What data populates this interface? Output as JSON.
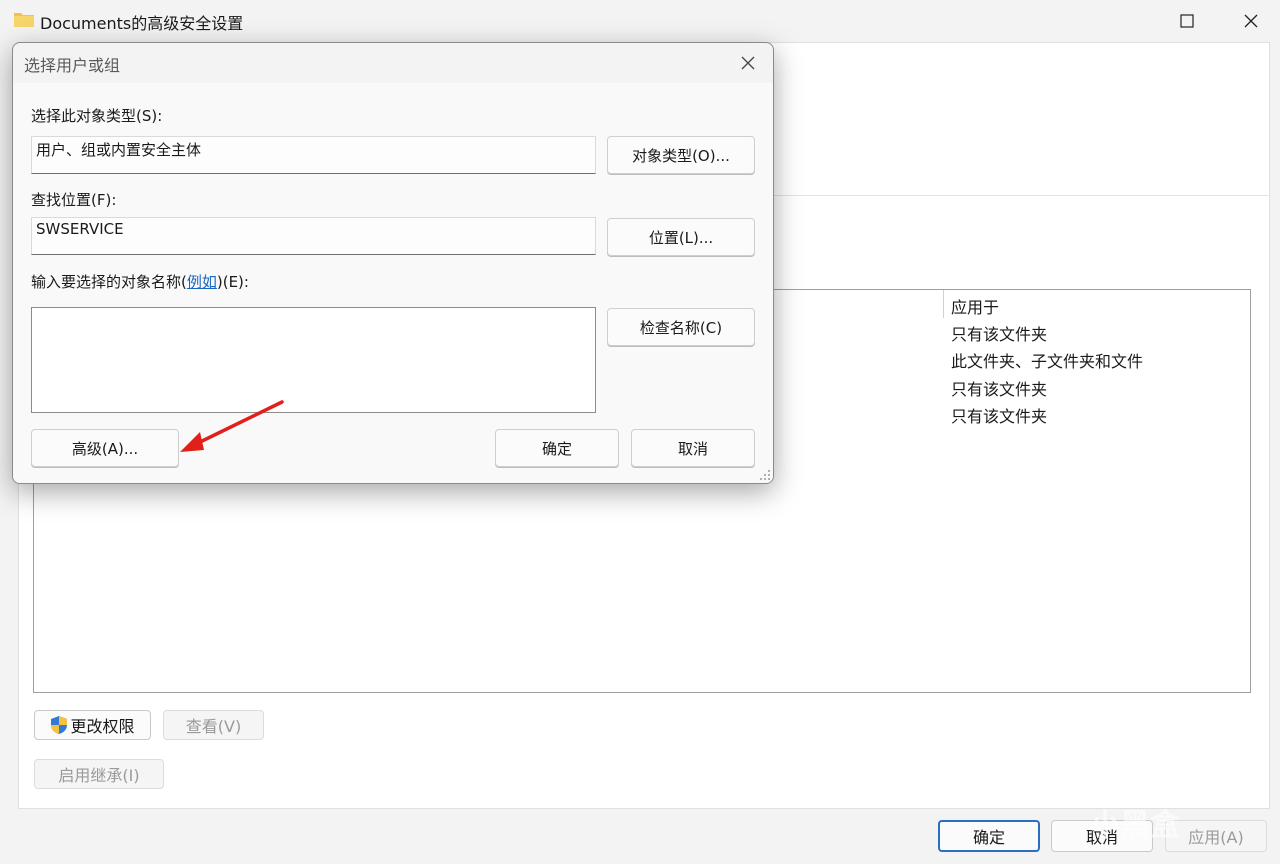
{
  "background_window": {
    "title": "Documents的高级安全设置",
    "column_header": "应用于",
    "rows": [
      "只有该文件夹",
      "此文件夹、子文件夹和文件",
      "只有该文件夹",
      "只有该文件夹"
    ],
    "change_permissions": "更改权限",
    "view": "查看(V)",
    "enable_inheritance": "启用继承(I)",
    "ok": "确定",
    "cancel": "取消",
    "apply": "应用(A)"
  },
  "dialog": {
    "title": "选择用户或组",
    "object_type_label": "选择此对象类型(S):",
    "object_type_value": "用户、组或内置安全主体",
    "object_types_button": "对象类型(O)...",
    "location_label": "查找位置(F):",
    "location_value": "SWSERVICE",
    "locations_button": "位置(L)...",
    "names_label_prefix": "输入要选择的对象名称(",
    "names_label_link": "例如",
    "names_label_suffix": ")(E):",
    "check_names_button": "检查名称(C)",
    "advanced_button": "高级(A)...",
    "ok_button": "确定",
    "cancel_button": "取消"
  },
  "watermark": "小黑盒",
  "colors": {
    "link": "#1766c2",
    "arrow": "#e0201b",
    "primary_border": "#2b6fc2"
  }
}
